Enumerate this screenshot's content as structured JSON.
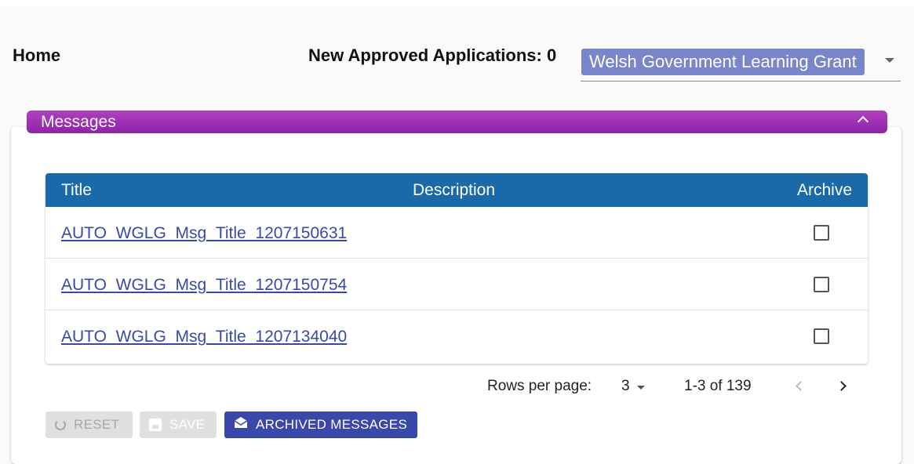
{
  "header": {
    "home_label": "Home",
    "approved_label": "New Approved Applications: 0",
    "scheme_selected": "Welsh Government Learning Grant"
  },
  "messages": {
    "panel_title": "Messages",
    "columns": [
      "Title",
      "Description",
      "Archive"
    ],
    "rows": [
      {
        "title": "AUTO_WGLG_Msg_Title_1207150631",
        "description": "",
        "archived": false
      },
      {
        "title": "AUTO_WGLG_Msg_Title_1207150754",
        "description": "",
        "archived": false
      },
      {
        "title": "AUTO_WGLG_Msg_Title_1207134040",
        "description": "",
        "archived": false
      }
    ],
    "pagination": {
      "rows_per_page_label": "Rows per page:",
      "rows_per_page_value": "3",
      "range_label": "1-3 of 139"
    }
  },
  "actions": {
    "reset_label": "RESET",
    "save_label": "SAVE",
    "archived_label": "ARCHIVED MESSAGES"
  },
  "colors": {
    "header_purple": "#9c27b0",
    "table_header_blue": "#1a6aaa",
    "chip_indigo": "#7986cb",
    "primary_button": "#3949ab"
  }
}
